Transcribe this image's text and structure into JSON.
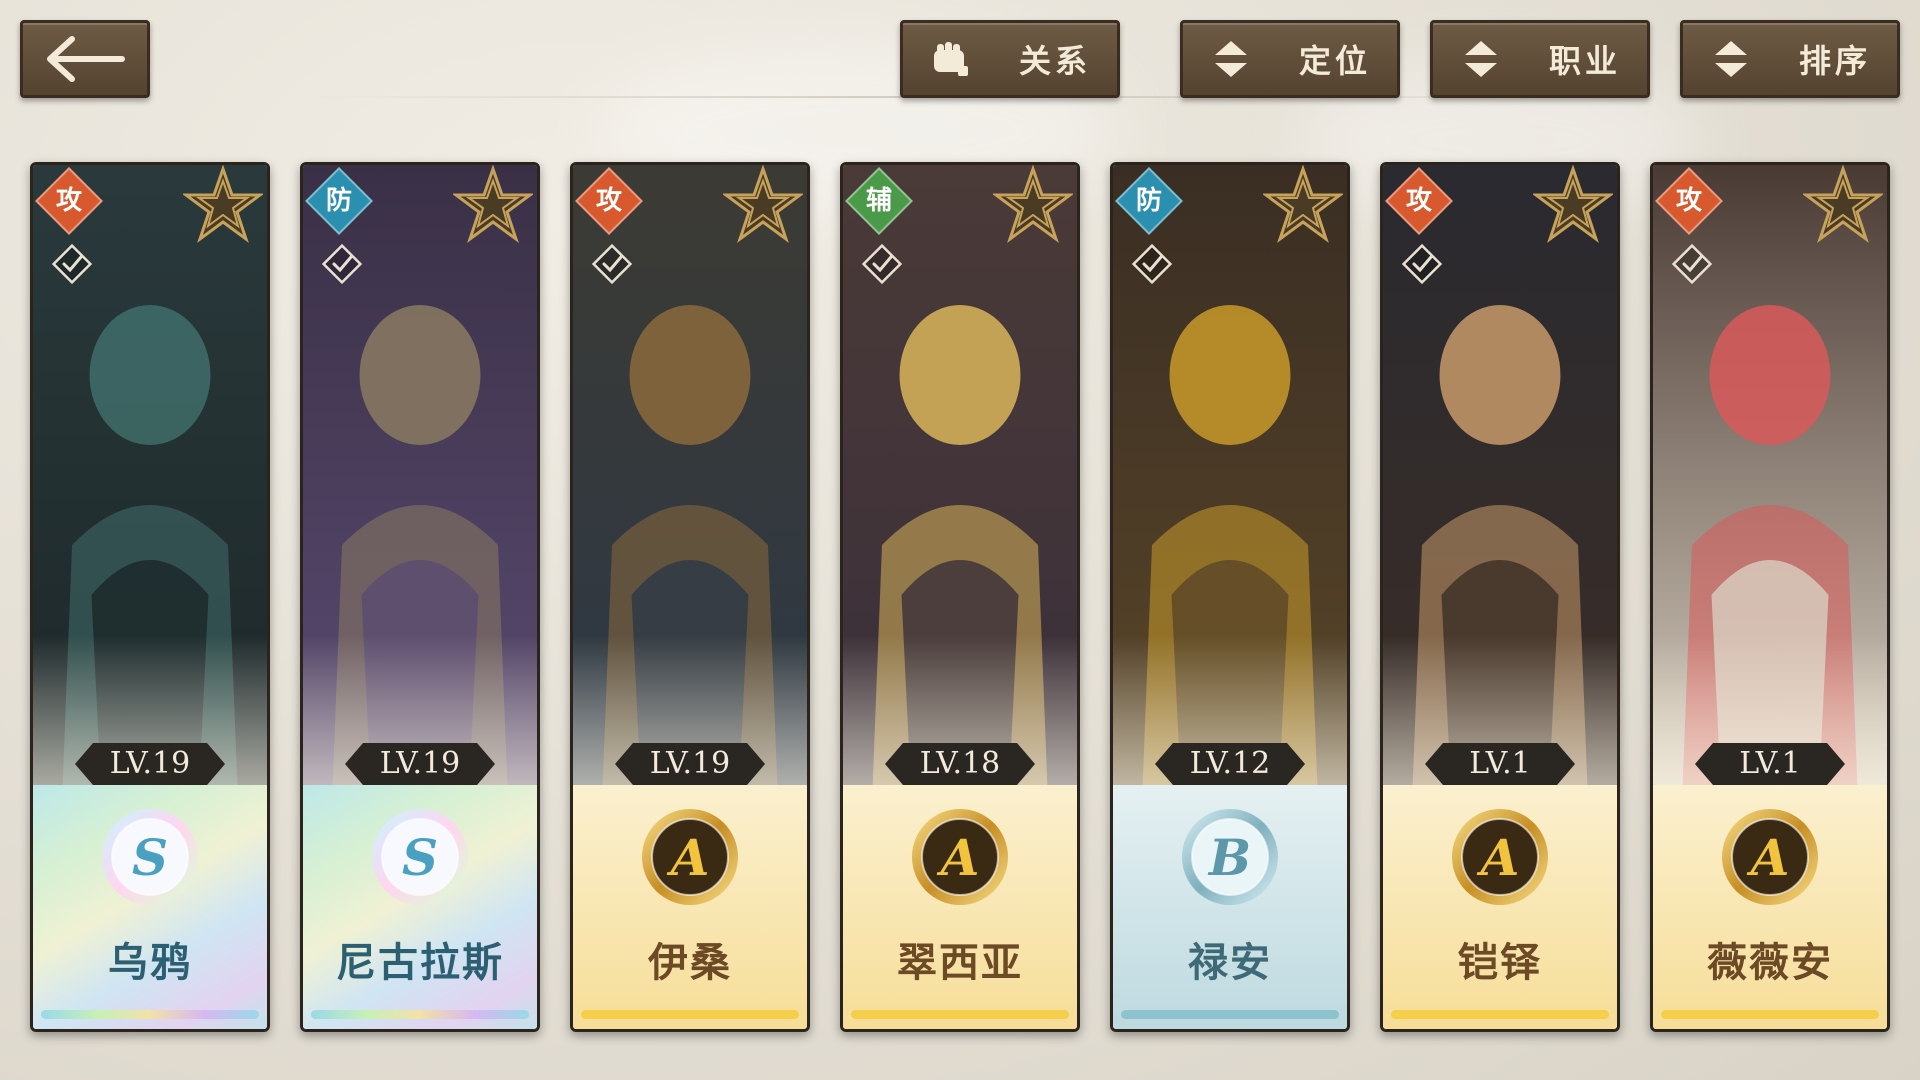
{
  "toolbar": {
    "relation_label": "关系",
    "position_label": "定位",
    "class_label": "职业",
    "sort_label": "排序"
  },
  "heroes": [
    {
      "role": "攻",
      "role_type": "attack",
      "level": "LV.19",
      "grade": "S",
      "name": "乌鸦",
      "palette": [
        "#2a3a3c",
        "#1c2628",
        "#3f6d6a"
      ]
    },
    {
      "role": "防",
      "role_type": "defense",
      "level": "LV.19",
      "grade": "S",
      "name": "尼古拉斯",
      "palette": [
        "#3a3046",
        "#5a4b72",
        "#8a7a62"
      ]
    },
    {
      "role": "攻",
      "role_type": "attack",
      "level": "LV.19",
      "grade": "A",
      "name": "伊桑",
      "palette": [
        "#3c3a34",
        "#2c3846",
        "#8a6a3c"
      ]
    },
    {
      "role": "辅",
      "role_type": "support",
      "level": "LV.18",
      "grade": "A",
      "name": "翠西亚",
      "palette": [
        "#4a3a38",
        "#3a2f3a",
        "#d9b45a"
      ]
    },
    {
      "role": "防",
      "role_type": "defense",
      "level": "LV.12",
      "grade": "B",
      "name": "禄安",
      "palette": [
        "#3a2e24",
        "#5a4628",
        "#c99a2a"
      ]
    },
    {
      "role": "攻",
      "role_type": "attack",
      "level": "LV.1",
      "grade": "A",
      "name": "铠铎",
      "palette": [
        "#2a2a30",
        "#3b2d26",
        "#c79a6a"
      ]
    },
    {
      "role": "攻",
      "role_type": "attack",
      "level": "LV.1",
      "grade": "A",
      "name": "薇薇安",
      "palette": [
        "#4a3a34",
        "#d8cfc0",
        "#d85a5a"
      ]
    }
  ]
}
